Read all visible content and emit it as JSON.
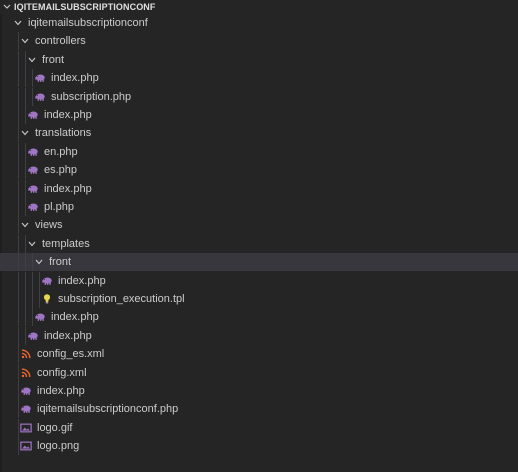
{
  "explorer": {
    "section_title": "IQITEMAILSUBSCRIPTIONCONF",
    "items": [
      {
        "label": "iqitemailsubscriptionconf",
        "type": "folder",
        "depth": 0,
        "expanded": true
      },
      {
        "label": "controllers",
        "type": "folder",
        "depth": 1,
        "expanded": true
      },
      {
        "label": "front",
        "type": "folder",
        "depth": 2,
        "expanded": true
      },
      {
        "label": "index.php",
        "type": "php",
        "depth": 3
      },
      {
        "label": "subscription.php",
        "type": "php",
        "depth": 3
      },
      {
        "label": "index.php",
        "type": "php",
        "depth": 2
      },
      {
        "label": "translations",
        "type": "folder",
        "depth": 1,
        "expanded": true
      },
      {
        "label": "en.php",
        "type": "php",
        "depth": 2
      },
      {
        "label": "es.php",
        "type": "php",
        "depth": 2
      },
      {
        "label": "index.php",
        "type": "php",
        "depth": 2
      },
      {
        "label": "pl.php",
        "type": "php",
        "depth": 2
      },
      {
        "label": "views",
        "type": "folder",
        "depth": 1,
        "expanded": true
      },
      {
        "label": "templates",
        "type": "folder",
        "depth": 2,
        "expanded": true
      },
      {
        "label": "front",
        "type": "folder",
        "depth": 3,
        "expanded": true,
        "selected": true
      },
      {
        "label": "index.php",
        "type": "php",
        "depth": 4
      },
      {
        "label": "subscription_execution.tpl",
        "type": "tpl",
        "depth": 4
      },
      {
        "label": "index.php",
        "type": "php",
        "depth": 3
      },
      {
        "label": "index.php",
        "type": "php",
        "depth": 2
      },
      {
        "label": "config_es.xml",
        "type": "xml",
        "depth": 1
      },
      {
        "label": "config.xml",
        "type": "xml",
        "depth": 1
      },
      {
        "label": "index.php",
        "type": "php",
        "depth": 1
      },
      {
        "label": "iqitemailsubscriptionconf.php",
        "type": "php",
        "depth": 1
      },
      {
        "label": "logo.gif",
        "type": "image",
        "depth": 1
      },
      {
        "label": "logo.png",
        "type": "image",
        "depth": 1
      }
    ]
  },
  "icons": {
    "php": "elephant-icon",
    "tpl": "bulb-icon",
    "xml": "rss-icon",
    "image": "image-icon",
    "folder_open": "chevron-down-icon"
  },
  "colors": {
    "background": "#252526",
    "selected_row": "#37373d",
    "text": "#cccccc",
    "php_icon": "#a074c4",
    "tpl_icon": "#e8d44d",
    "xml_icon": "#f16529",
    "image_icon": "#a074c4"
  }
}
